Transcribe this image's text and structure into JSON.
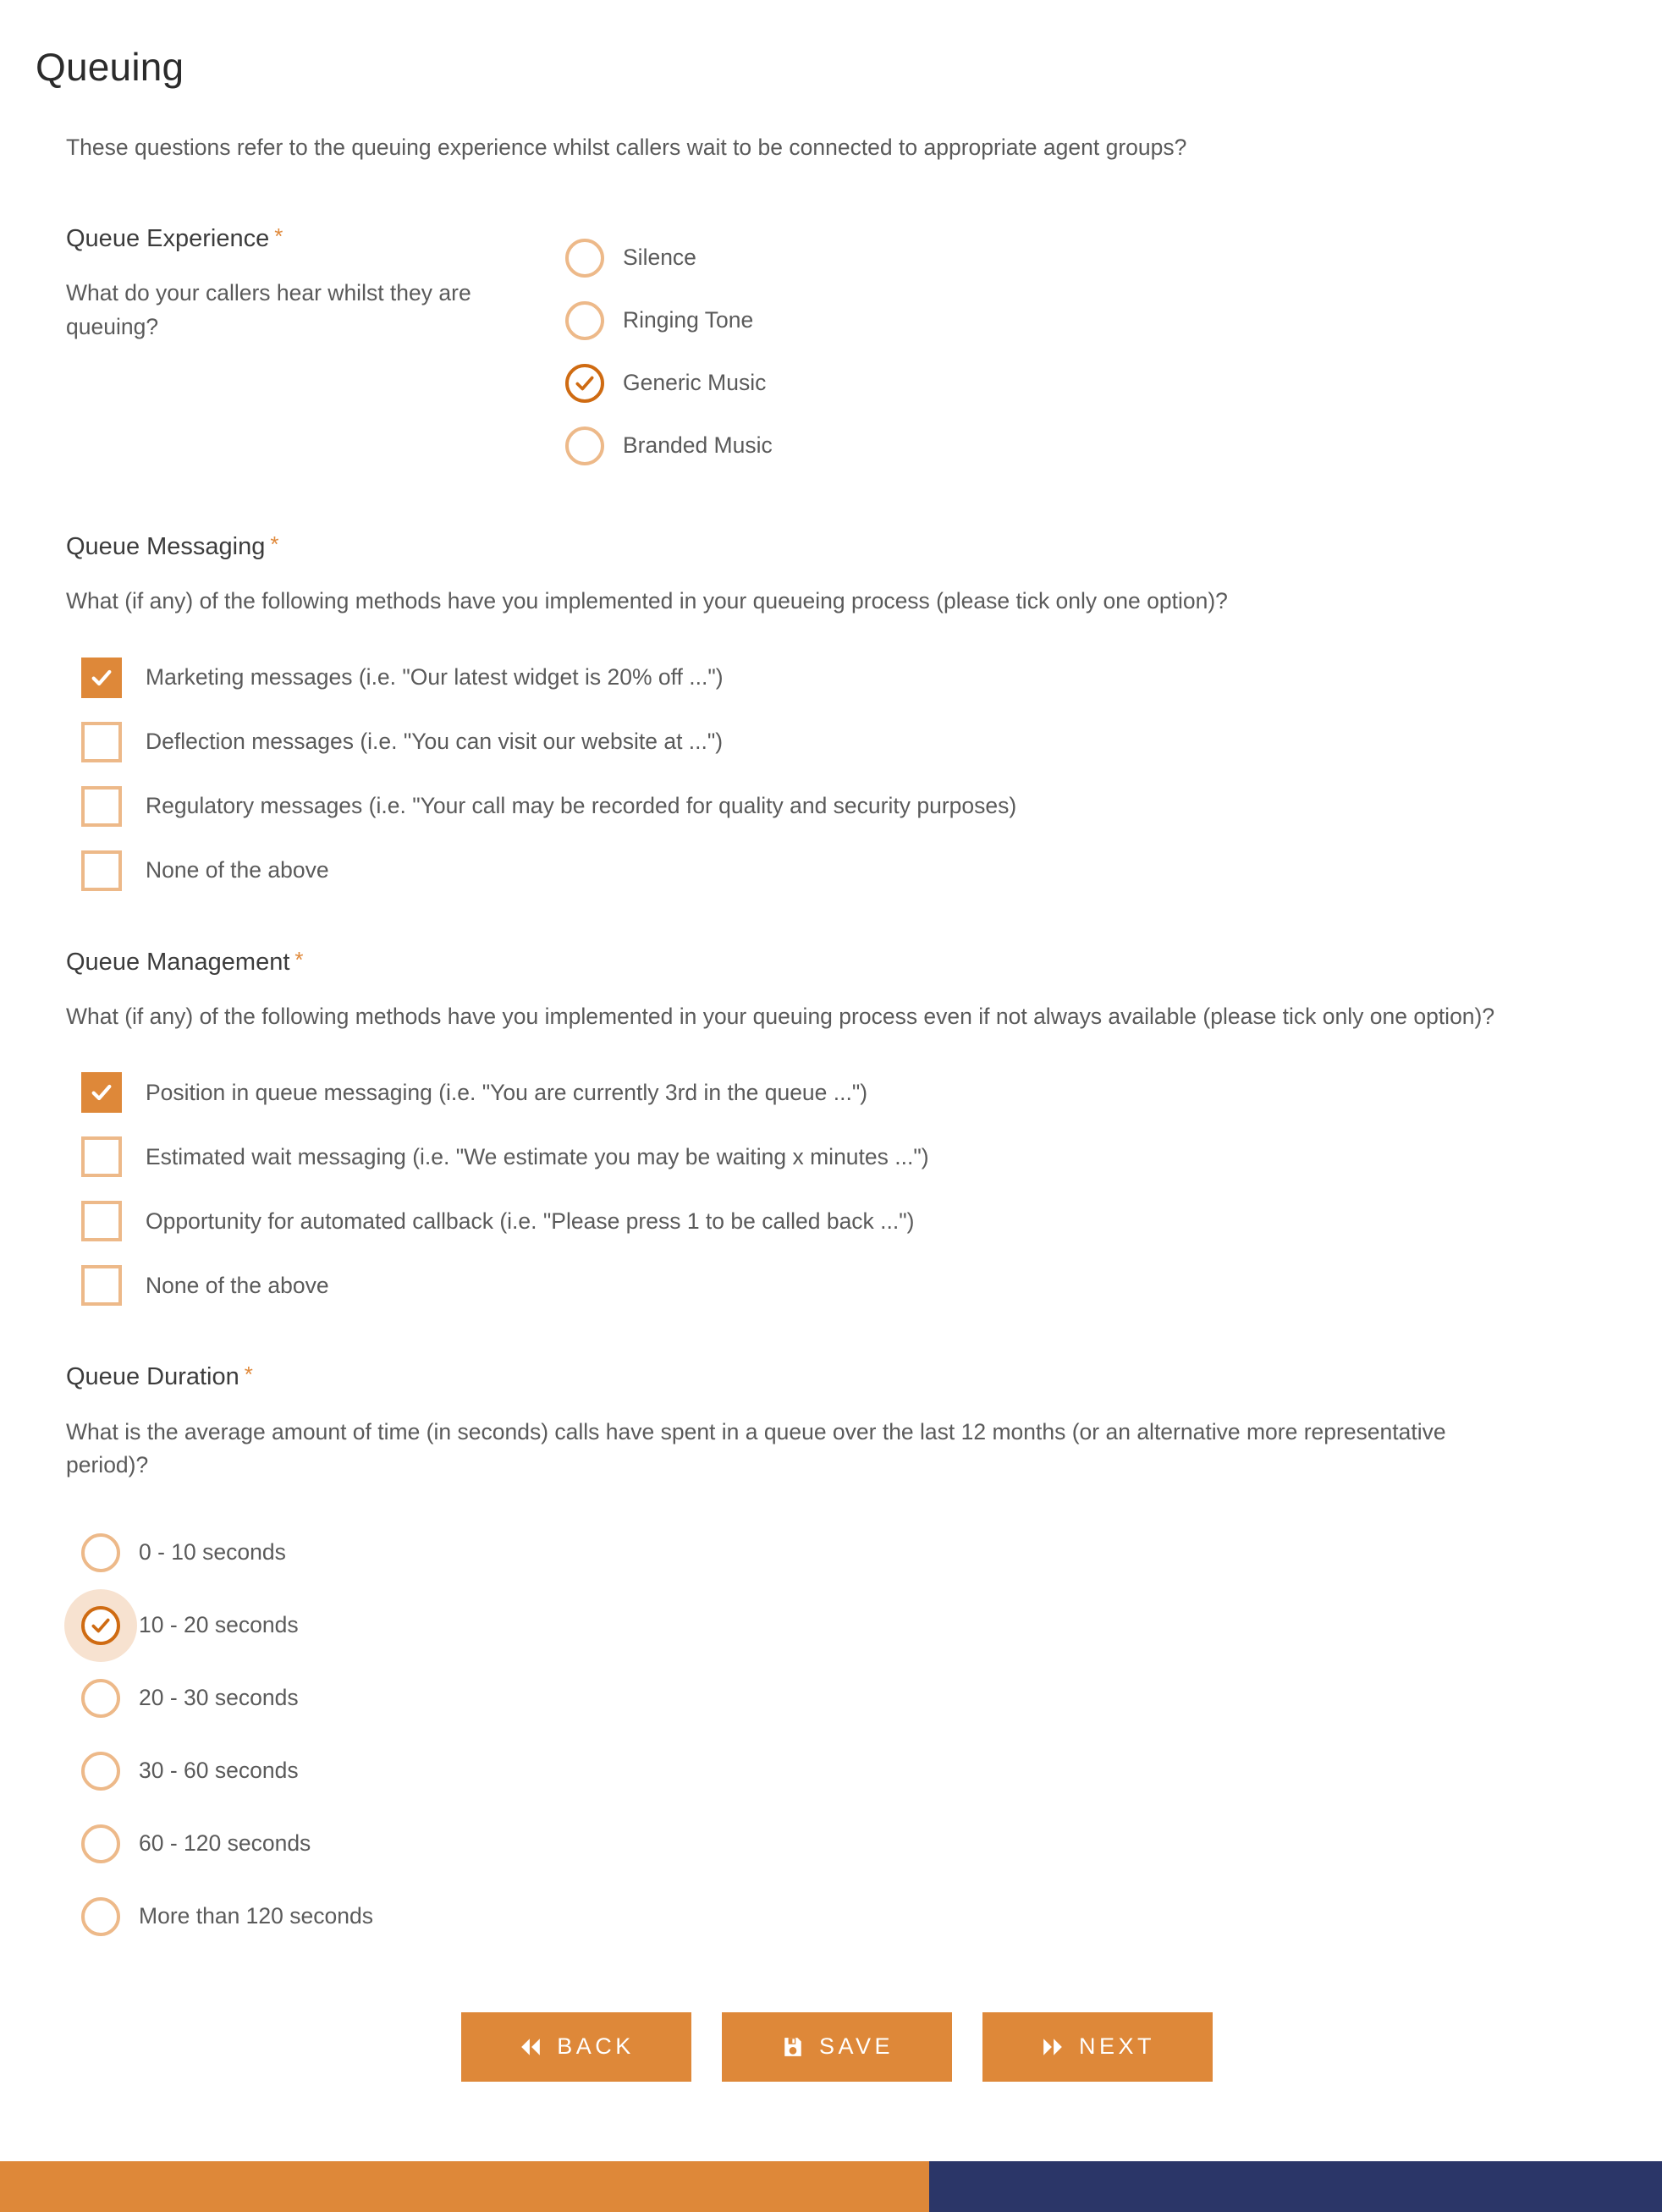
{
  "page": {
    "title": "Queuing",
    "intro": "These questions refer to the queuing experience whilst callers wait to be connected to appropriate agent groups?"
  },
  "colors": {
    "accent_orange": "#de8839",
    "accent_orange_dark": "#cf6b12",
    "accent_orange_light": "#edb989",
    "halo": "#f7e2d0",
    "footer_navy": "#2b3668",
    "text_body": "#5a5a5a",
    "text_heading": "#3c3c3c",
    "required_star": "#e08a3c"
  },
  "questions": [
    {
      "id": "queue-experience",
      "label": "Queue Experience",
      "required_marker": "*",
      "help": "What do your callers hear whilst they are queuing?",
      "type": "radio",
      "options": [
        {
          "label": "Silence",
          "checked": false
        },
        {
          "label": "Ringing Tone",
          "checked": false
        },
        {
          "label": "Generic Music",
          "checked": true
        },
        {
          "label": "Branded Music",
          "checked": false
        }
      ]
    },
    {
      "id": "queue-messaging",
      "label": "Queue Messaging",
      "required_marker": "*",
      "help": "What (if any) of the following methods have you implemented in your queueing process (please tick only one option)?",
      "type": "checkbox",
      "options": [
        {
          "label": "Marketing messages (i.e. \"Our latest widget is 20% off ...\")",
          "checked": true
        },
        {
          "label": "Deflection messages (i.e. \"You can visit our website at ...\")",
          "checked": false
        },
        {
          "label": "Regulatory messages (i.e. \"Your call may be recorded for quality and security purposes)",
          "checked": false
        },
        {
          "label": "None of the above",
          "checked": false
        }
      ]
    },
    {
      "id": "queue-management",
      "label": "Queue Management",
      "required_marker": "*",
      "help": "What (if any) of the following methods have you implemented in your queuing process even if not always available (please tick only one option)?",
      "type": "checkbox",
      "options": [
        {
          "label": "Position in queue messaging (i.e. \"You are currently 3rd in the queue ...\")",
          "checked": true
        },
        {
          "label": "Estimated wait messaging (i.e. \"We estimate you may be waiting x minutes ...\")",
          "checked": false
        },
        {
          "label": "Opportunity for automated callback (i.e. \"Please press 1 to be called back ...\")",
          "checked": false
        },
        {
          "label": "None of the above",
          "checked": false
        }
      ]
    },
    {
      "id": "queue-duration",
      "label": "Queue Duration",
      "required_marker": "*",
      "help": "What is the average amount of time (in seconds) calls have spent in a queue over the last 12 months (or an alternative more representative period)?",
      "type": "radio",
      "options": [
        {
          "label": "0 - 10 seconds",
          "checked": false
        },
        {
          "label": "10 - 20 seconds",
          "checked": true,
          "focused": true
        },
        {
          "label": "20 - 30 seconds",
          "checked": false
        },
        {
          "label": "30 - 60 seconds",
          "checked": false
        },
        {
          "label": "60 - 120 seconds",
          "checked": false
        },
        {
          "label": "More than 120 seconds",
          "checked": false
        }
      ]
    }
  ],
  "buttons": [
    {
      "id": "back",
      "label": "BACK",
      "icon": "double-chevron-left-icon"
    },
    {
      "id": "save",
      "label": "SAVE",
      "icon": "floppy-disk-icon"
    },
    {
      "id": "next",
      "label": "NEXT",
      "icon": "double-chevron-right-icon"
    }
  ]
}
